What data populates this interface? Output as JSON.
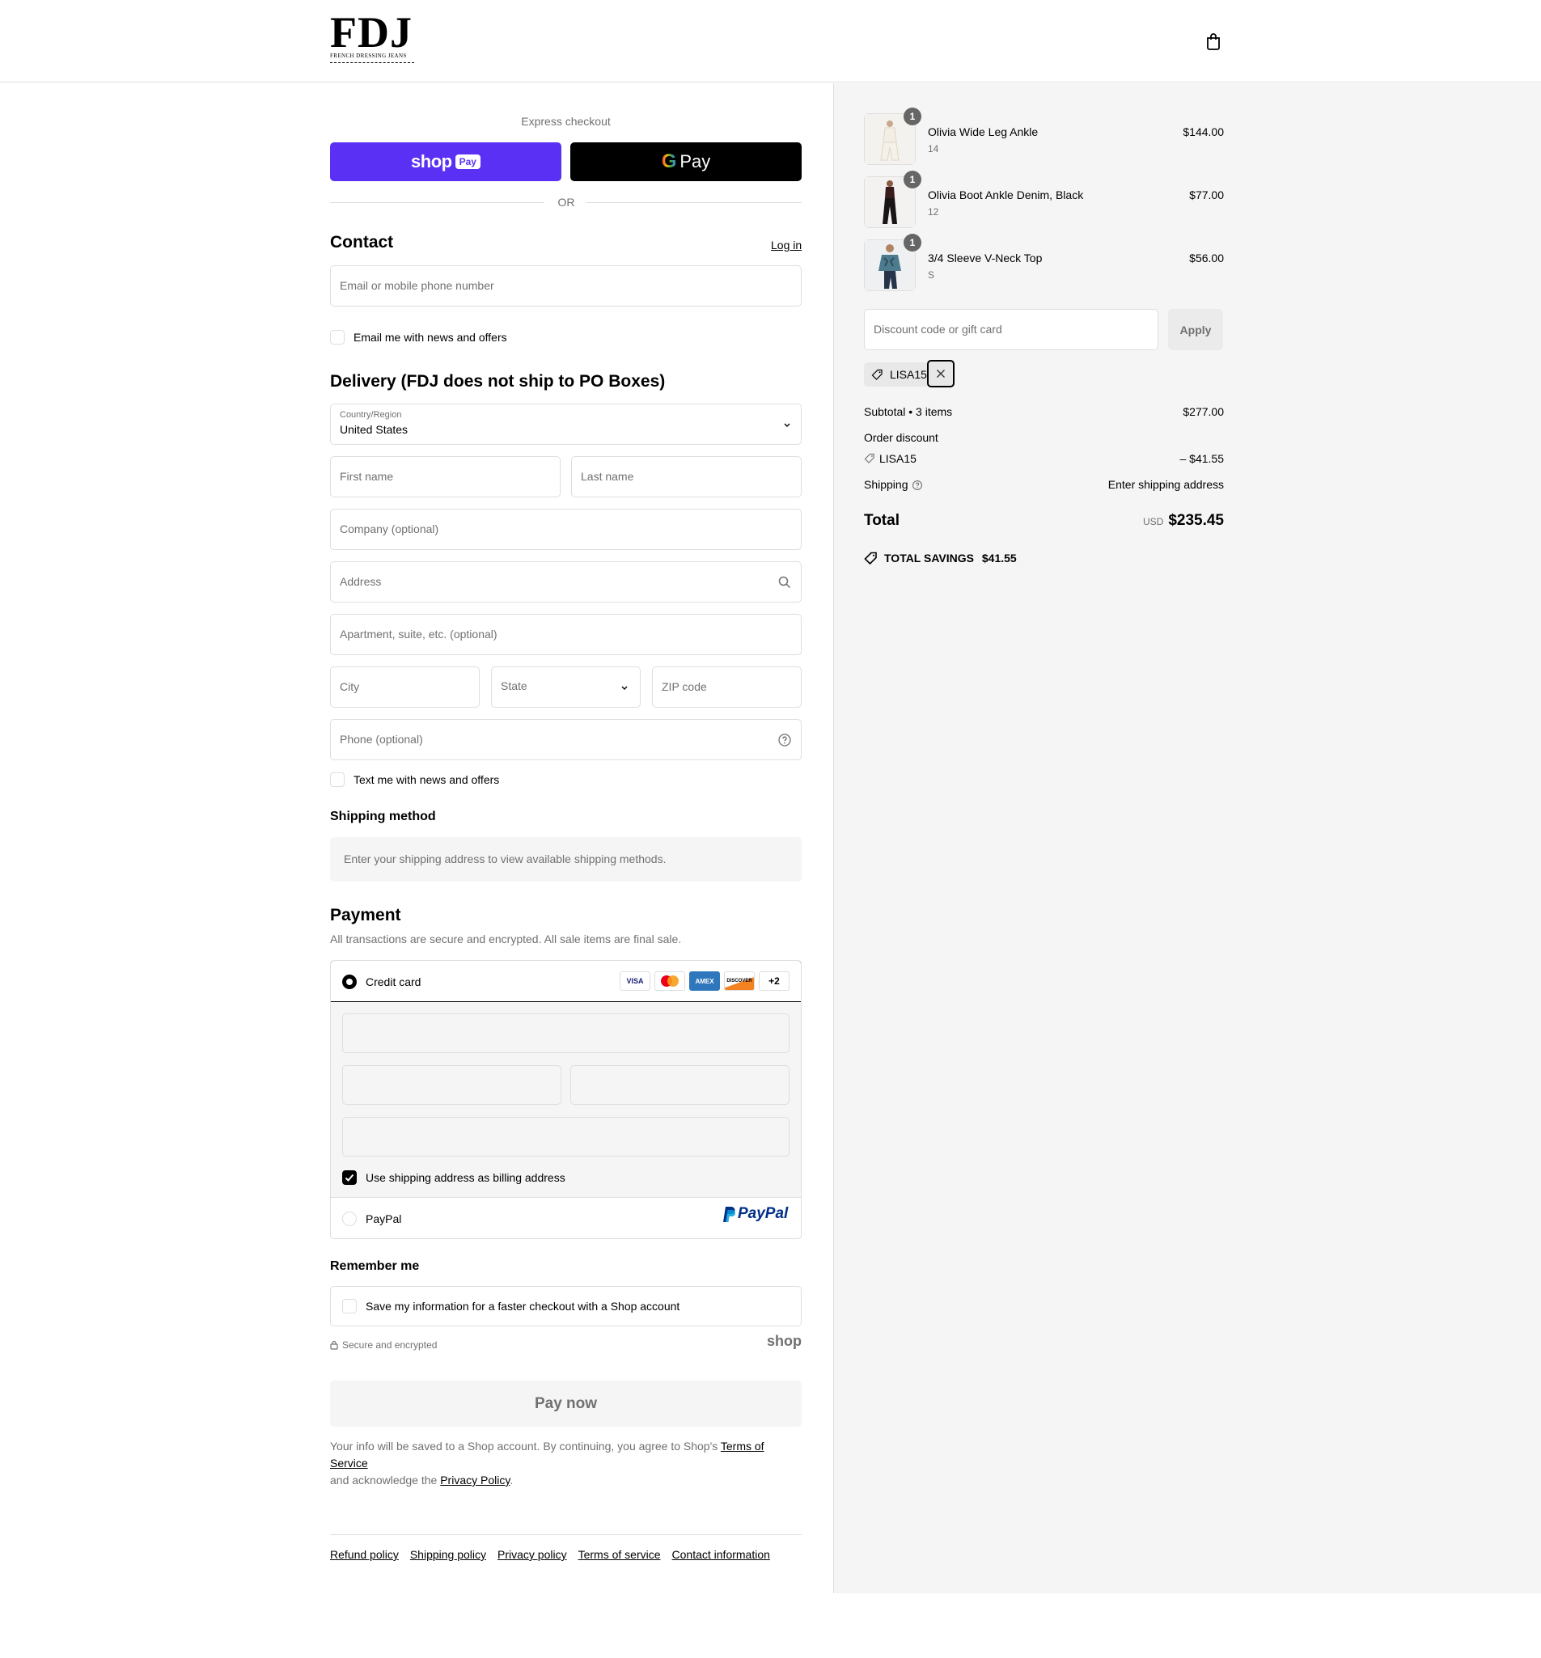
{
  "header": {
    "logo_text": "FDJ",
    "logo_tagline": "FRENCH DRESSING JEANS",
    "cart_icon": "shopping-bag-icon"
  },
  "express": {
    "title": "Express checkout",
    "shop_pay_word": "shop",
    "shop_pay_pill": "Pay",
    "gpay_g": "G",
    "gpay_word": "Pay",
    "or": "OR"
  },
  "contact": {
    "heading": "Contact",
    "login": "Log in",
    "email_placeholder": "Email or mobile phone number",
    "newsletter_label": "Email me with news and offers"
  },
  "delivery": {
    "heading": "Delivery (FDJ does not ship to PO Boxes)",
    "country_label": "Country/Region",
    "country_value": "United States",
    "first_name": "First name",
    "last_name": "Last name",
    "company": "Company (optional)",
    "address": "Address",
    "apartment": "Apartment, suite, etc. (optional)",
    "city": "City",
    "state": "State",
    "zip": "ZIP code",
    "phone": "Phone (optional)",
    "sms_label": "Text me with news and offers"
  },
  "shipping_method": {
    "heading": "Shipping method",
    "info": "Enter your shipping address to view available shipping methods."
  },
  "payment": {
    "heading": "Payment",
    "subtitle": "All transactions are secure and encrypted. All sale items are final sale.",
    "credit_card_label": "Credit card",
    "cards": [
      "VISA",
      "MC",
      "AMEX",
      "DISCOVER"
    ],
    "more_cards": "+2",
    "billing_label": "Use shipping address as billing address",
    "paypal_label": "PayPal",
    "paypal_logo": "PayPal"
  },
  "remember": {
    "heading": "Remember me",
    "label": "Save my information for a faster checkout with a Shop account",
    "secure": "Secure and encrypted",
    "shop_logo": "shop"
  },
  "pay_now": "Pay now",
  "legal": {
    "text1": "Your info will be saved to a Shop account. By continuing, you agree to Shop's ",
    "terms": "Terms of Service",
    "text2": "and acknowledge the ",
    "privacy": "Privacy Policy",
    "text3": "."
  },
  "footer": {
    "links": [
      "Refund policy",
      "Shipping policy",
      "Privacy policy",
      "Terms of service",
      "Contact information"
    ]
  },
  "summary": {
    "items": [
      {
        "qty": "1",
        "name": "Olivia Wide Leg Ankle",
        "variant": "14",
        "price": "$144.00"
      },
      {
        "qty": "1",
        "name": "Olivia Boot Ankle Denim, Black",
        "variant": "12",
        "price": "$77.00"
      },
      {
        "qty": "1",
        "name": "3/4 Sleeve V-Neck Top",
        "variant": "S",
        "price": "$56.00"
      }
    ],
    "discount_placeholder": "Discount code or gift card",
    "apply": "Apply",
    "applied_code": "LISA15",
    "subtotal_label": "Subtotal • 3 items",
    "subtotal_value": "$277.00",
    "order_discount_label": "Order discount",
    "discount_code": "LISA15",
    "discount_value": "– $41.55",
    "shipping_label": "Shipping",
    "shipping_value": "Enter shipping address",
    "total_label": "Total",
    "currency": "USD",
    "total_value": "$235.45",
    "savings_label": "TOTAL SAVINGS",
    "savings_value": "$41.55"
  }
}
